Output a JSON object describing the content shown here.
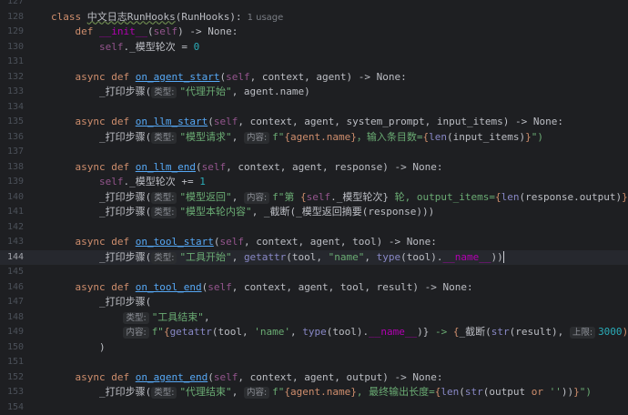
{
  "editor": {
    "current_line": 144,
    "class_line": {
      "kw": "class",
      "name": "中文日志RunHooks",
      "base": "(RunHooks):",
      "usage": "1 usage"
    },
    "lines": {
      "l129_def": "def",
      "l129_init": "__init__",
      "l129_rest1": "(",
      "l129_self": "self",
      "l129_rest2": ") -> None:",
      "l130_self": "self",
      "l130_attr": "._模型轮次",
      "l130_eq": " = ",
      "l130_num": "0",
      "l132_async": "async def",
      "l132_fn": "on_agent_start",
      "l132_p1": "(",
      "l132_self": "self",
      "l132_p2": ", context, agent) -> None:",
      "l133_call": "_打印步骤(",
      "l133_hint": "类型:",
      "l133_str": "\"代理开始\"",
      "l133_rest": ", agent.name)",
      "l135_async": "async def",
      "l135_fn": "on_llm_start",
      "l135_p1": "(",
      "l135_self": "self",
      "l135_p2": ", context, agent, system_prompt, input_items) -> None:",
      "l136_call": "_打印步骤(",
      "l136_hint1": "类型:",
      "l136_str1": "\"模型请求\"",
      "l136_sep": ", ",
      "l136_hint2": "内容:",
      "l136_f": "f\"",
      "l136_e1": "{agent.name}",
      "l136_s2": "，输入条目数=",
      "l136_e2o": "{",
      "l136_len": "len",
      "l136_e2": "(input_items)",
      "l136_e2c": "}",
      "l136_end": "\")",
      "l138_async": "async def",
      "l138_fn": "on_llm_end",
      "l138_p1": "(",
      "l138_self": "self",
      "l138_p2": ", context, agent, response) -> None:",
      "l139_self": "self",
      "l139_rest": "._模型轮次 += ",
      "l139_num": "1",
      "l140_call": "_打印步骤(",
      "l140_hint1": "类型:",
      "l140_str1": "\"模型返回\"",
      "l140_sep": ", ",
      "l140_hint2": "内容:",
      "l140_f": "f\"第 ",
      "l140_e1o": "{",
      "l140_self": "self",
      "l140_e1": "._模型轮次}",
      "l140_s2": " 轮, output_items=",
      "l140_e2o": "{",
      "l140_len": "len",
      "l140_e2": "(response.output)",
      "l140_e2c": "}",
      "l140_end": "\")",
      "l141_call": "_打印步骤(",
      "l141_hint": "类型:",
      "l141_str": "\"模型本轮内容\"",
      "l141_rest": ", _截断(_模型返回摘要(response)))",
      "l143_async": "async def",
      "l143_fn": "on_tool_start",
      "l143_p1": "(",
      "l143_self": "self",
      "l143_p2": ", context, agent, tool) -> None:",
      "l144_call": "_打印步骤(",
      "l144_hint": "类型:",
      "l144_str1": "\"工具开始\"",
      "l144_sep1": ", ",
      "l144_getattr": "getattr",
      "l144_p1": "(tool, ",
      "l144_str2": "\"name\"",
      "l144_sep2": ", ",
      "l144_type": "type",
      "l144_p2": "(tool).",
      "l144_dunder": "__name__",
      "l144_end": "))",
      "l146_async": "async def",
      "l146_fn": "on_tool_end",
      "l146_p1": "(",
      "l146_self": "self",
      "l146_p2": ", context, agent, tool, result) -> None:",
      "l147_call": "_打印步骤(",
      "l148_hint": "类型:",
      "l148_str": "\"工具结束\"",
      "l148_end": ",",
      "l149_hint": "内容:",
      "l149_f": "f\"",
      "l149_e1o": "{",
      "l149_getattr": "getattr",
      "l149_p1": "(tool, ",
      "l149_str": "'name'",
      "l149_sep": ", ",
      "l149_type": "type",
      "l149_p2": "(tool).",
      "l149_dunder": "__name__",
      "l149_p3": ")}",
      "l149_arrow": " -> ",
      "l149_e2o": "{",
      "l149_trunc": "_截断(",
      "l149_str2": "str",
      "l149_p4": "(result), ",
      "l149_hint2": "上限:",
      "l149_num": "3000",
      "l149_e2c": ")}",
      "l149_end": "\",",
      "l150_close": ")",
      "l152_async": "async def",
      "l152_fn": "on_agent_end",
      "l152_p1": "(",
      "l152_self": "self",
      "l152_p2": ", context, agent, output) -> None:",
      "l153_call": "_打印步骤(",
      "l153_hint1": "类型:",
      "l153_str1": "\"代理结束\"",
      "l153_sep": ", ",
      "l153_hint2": "内容:",
      "l153_f": "f\"",
      "l153_e1": "{agent.name}",
      "l153_s2": ", 最终输出长度=",
      "l153_e2o": "{",
      "l153_len": "len",
      "l153_p": "(",
      "l153_str": "str",
      "l153_p2": "(output ",
      "l153_or": "or",
      "l153_sq": " ''",
      "l153_p3": "))",
      "l153_e2c": "}",
      "l153_end": "\")"
    },
    "line_numbers": [
      "127",
      "128",
      "129",
      "130",
      "131",
      "132",
      "133",
      "134",
      "135",
      "136",
      "137",
      "138",
      "139",
      "140",
      "141",
      "142",
      "143",
      "144",
      "145",
      "146",
      "147",
      "148",
      "149",
      "150",
      "151",
      "152",
      "153",
      "154"
    ]
  },
  "colors": {
    "background": "#1e1f22",
    "keyword": "#cf8e6d",
    "function": "#56a8f5",
    "string": "#6aab73",
    "self": "#94558d",
    "number": "#2aacb8"
  }
}
